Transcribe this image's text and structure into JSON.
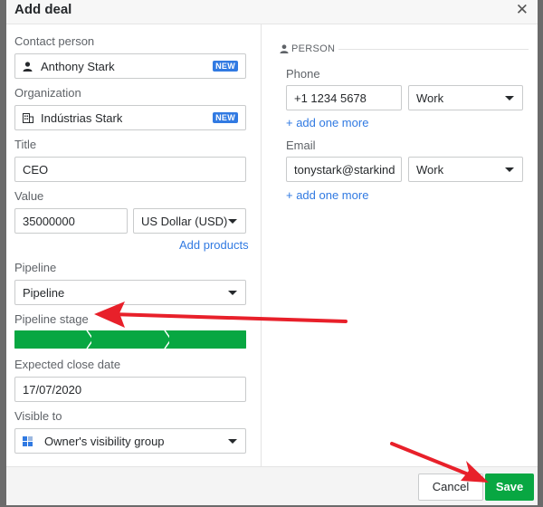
{
  "dialog": {
    "title": "Add deal"
  },
  "left": {
    "contact_label": "Contact person",
    "contact_value": "Anthony Stark",
    "contact_badge": "NEW",
    "org_label": "Organization",
    "org_value": "Indústrias Stark",
    "org_badge": "NEW",
    "title_label": "Title",
    "title_value": "CEO",
    "value_label": "Value",
    "value_amount": "35000000",
    "currency": "US Dollar (USD)",
    "add_products": "Add products",
    "pipeline_label": "Pipeline",
    "pipeline_value": "Pipeline",
    "stage_label": "Pipeline stage",
    "stage_count": 3,
    "stage_color": "#08a742",
    "close_date_label": "Expected close date",
    "close_date_value": "17/07/2020",
    "visible_label": "Visible to",
    "visible_value": "Owner's visibility group"
  },
  "right": {
    "section": "PERSON",
    "phone_label": "Phone",
    "phone_value": "+1 1234 5678",
    "phone_type": "Work",
    "add_phone": "+ add one more",
    "email_label": "Email",
    "email_value": "tonystark@starkind",
    "email_type": "Work",
    "add_email": "+ add one more"
  },
  "footer": {
    "cancel": "Cancel",
    "save": "Save"
  },
  "colors": {
    "accent": "#317ae2",
    "success": "#08a742",
    "annotation": "#e8202a"
  }
}
